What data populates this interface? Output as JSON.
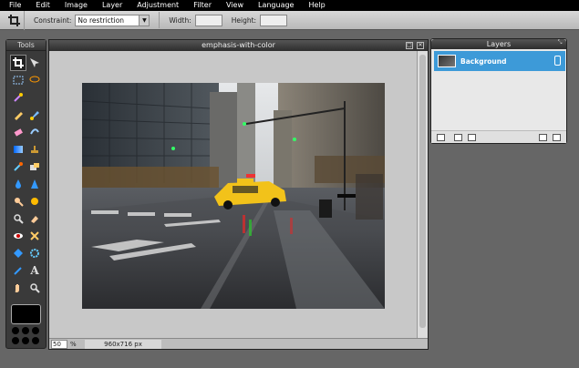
{
  "menu": [
    "File",
    "Edit",
    "Image",
    "Layer",
    "Adjustment",
    "Filter",
    "View",
    "Language",
    "Help"
  ],
  "options": {
    "constraint_label": "Constraint:",
    "constraint_value": "No restriction",
    "width_label": "Width:",
    "height_label": "Height:",
    "tool_icon": "crop-icon"
  },
  "tools_panel": {
    "title": "Tools",
    "tools": [
      "crop",
      "move",
      "marquee",
      "lasso",
      "wand",
      "pencil",
      "brush",
      "eraser",
      "smudge",
      "gradient",
      "stamp",
      "replace-color",
      "draw-shape",
      "blur",
      "sharpen",
      "dodge",
      "burn",
      "zoom",
      "sponge",
      "red-eye",
      "colorize",
      "pinch",
      "bloat",
      "eyedropper",
      "type",
      "hand",
      "magnifier"
    ],
    "foreground_color": "#000000"
  },
  "image_window": {
    "title": "emphasis-with-color",
    "zoom_value": "50",
    "zoom_unit": "%",
    "dimensions": "960x716 px"
  },
  "layers_panel": {
    "title": "Layers",
    "layers": [
      {
        "name": "Background",
        "selected": true,
        "locked": true
      }
    ]
  },
  "colors": {
    "accent": "#3d9ad8",
    "taxi": "#f2c21a"
  }
}
